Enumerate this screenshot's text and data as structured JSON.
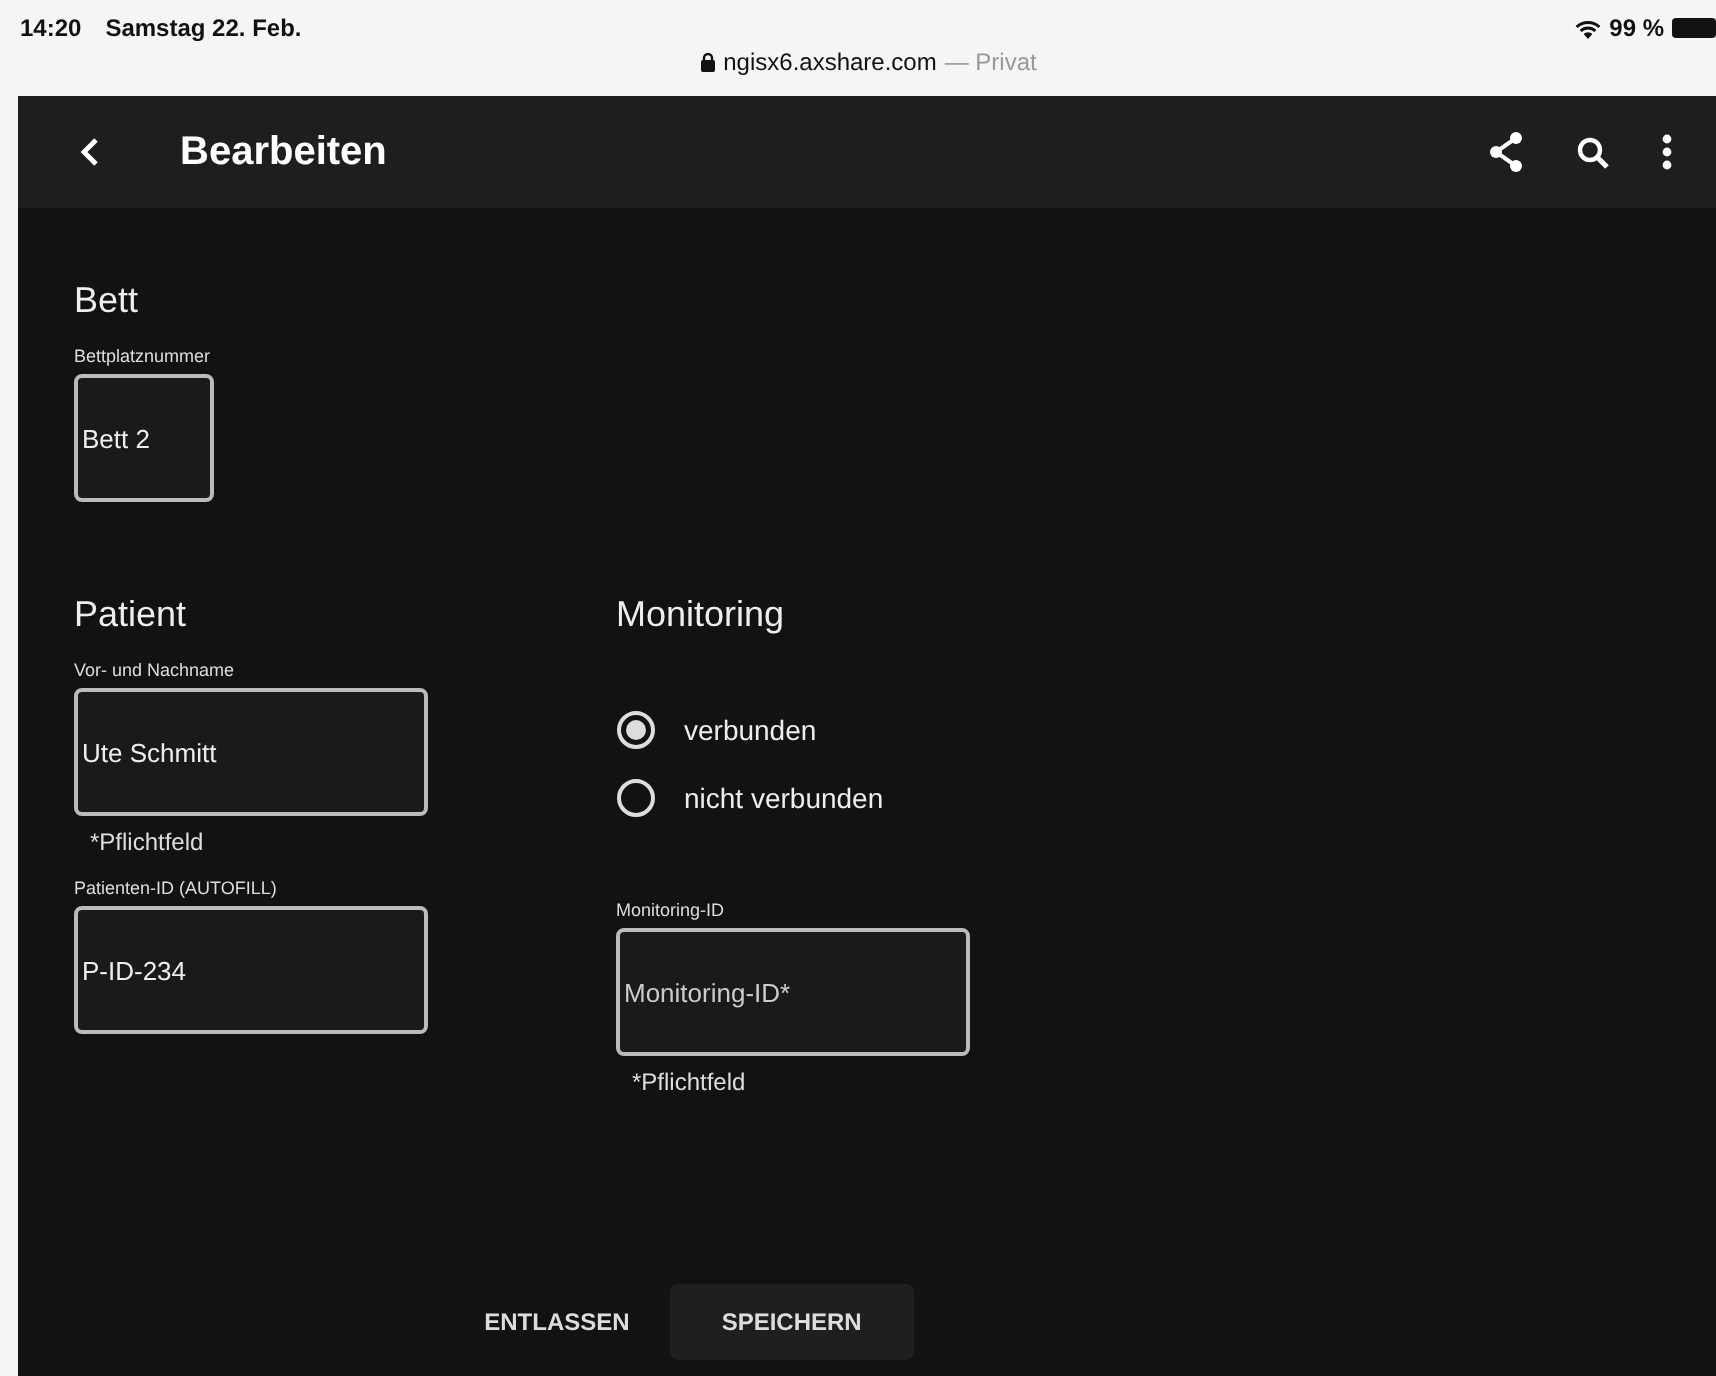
{
  "status_bar": {
    "time": "14:20",
    "date": "Samstag 22. Feb.",
    "battery": "99 %",
    "url": "ngisx6.axshare.com",
    "mode": "— Privat"
  },
  "app_bar": {
    "title": "Bearbeiten"
  },
  "bed": {
    "heading": "Bett",
    "label": "Bettplatznummer",
    "value": "Bett 2"
  },
  "patient": {
    "heading": "Patient",
    "name_label": "Vor- und Nachname",
    "name_value": "Ute Schmitt",
    "name_hint": "*Pflichtfeld",
    "id_label": "Patienten-ID (AUTOFILL)",
    "id_value": "P-ID-234"
  },
  "monitoring": {
    "heading": "Monitoring",
    "options": [
      {
        "label": "verbunden",
        "selected": true
      },
      {
        "label": "nicht verbunden",
        "selected": false
      }
    ],
    "id_label": "Monitoring-ID",
    "id_placeholder": "Monitoring-ID*",
    "id_hint": "*Pflichtfeld"
  },
  "buttons": [
    {
      "label": "ENTLASSEN",
      "kind": "text"
    },
    {
      "label": "SPEICHERN",
      "kind": "filled"
    }
  ]
}
